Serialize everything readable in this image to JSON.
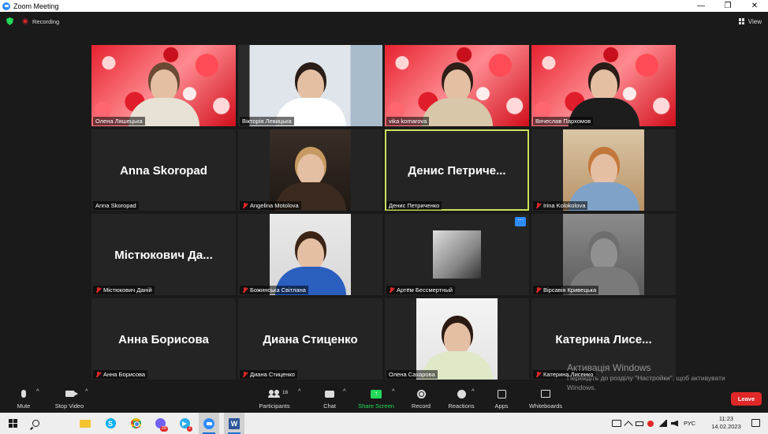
{
  "window": {
    "title": "Zoom Meeting",
    "minimize": "—",
    "restore": "❐",
    "close": "✕"
  },
  "status": {
    "recording_label": "Recording",
    "view_label": "View"
  },
  "tiles": [
    {
      "id": "olena-lyashchuk",
      "name": "Олена Ляшецька",
      "big": "",
      "muted": false,
      "video": "hearts"
    },
    {
      "id": "viktoriya",
      "name": "Вікторія Левицька",
      "big": "",
      "muted": false,
      "video": "room"
    },
    {
      "id": "vika",
      "name": "vika komarova",
      "big": "",
      "muted": false,
      "video": "hearts"
    },
    {
      "id": "vyacheslav",
      "name": "Вячеслав Пархомов",
      "big": "",
      "muted": false,
      "video": "hearts"
    },
    {
      "id": "anna-skoropad",
      "name": "Anna Skoropad",
      "big": "Anna Skoropad",
      "muted": false,
      "video": ""
    },
    {
      "id": "angelina",
      "name": "Angelina Motolova",
      "big": "",
      "muted": true,
      "video": "portrait"
    },
    {
      "id": "denys",
      "name": "Денис Петриченко",
      "big": "Денис  Петриче...",
      "muted": false,
      "video": "",
      "active": true
    },
    {
      "id": "irina",
      "name": "Irina Kolokolova",
      "big": "",
      "muted": true,
      "video": "chair"
    },
    {
      "id": "mistyukovych",
      "name": "Містюкович Даній",
      "big": "Містюкович  Да...",
      "muted": true,
      "video": ""
    },
    {
      "id": "bozhynska",
      "name": "Божинська Світлана",
      "big": "",
      "muted": true,
      "video": "blue"
    },
    {
      "id": "artem",
      "name": "Артём Бессмертный",
      "big": "",
      "muted": true,
      "video": "hand",
      "more": "···"
    },
    {
      "id": "virsaviya",
      "name": "Вірсавія Кривецька",
      "big": "",
      "muted": true,
      "video": "cat"
    },
    {
      "id": "anna-borysova",
      "name": "Анна Борисова",
      "big": "Анна Борисова",
      "muted": true,
      "video": ""
    },
    {
      "id": "diana",
      "name": "Диана Стиценко",
      "big": "Диана Стиценко",
      "muted": true,
      "video": ""
    },
    {
      "id": "olena-sakharova",
      "name": "Олена Сахарова",
      "big": "",
      "muted": false,
      "video": "woman"
    },
    {
      "id": "kateryna",
      "name": "Катерина Лисенко",
      "big": "Катерина  Лисе...",
      "muted": true,
      "video": ""
    }
  ],
  "toolbar": {
    "mute": "Mute",
    "stop_video": "Stop Video",
    "participants": "Participants",
    "participants_count": "16",
    "chat": "Chat",
    "share_screen": "Share Screen",
    "record": "Record",
    "reactions": "Reactions",
    "apps": "Apps",
    "whiteboards": "Whiteboards",
    "leave": "Leave"
  },
  "activation": {
    "title": "Активація Windows",
    "line1": "Перейдіть до розділу \"Настройки\", щоб активувати",
    "line2": "Windows."
  },
  "taskbar": {
    "viber_badge": "20",
    "telegram_badge": "2",
    "lang": "РУС",
    "time": "11:23",
    "date": "14.02.2023"
  },
  "colors": {
    "accent_blue": "#2d8cff",
    "share_green": "#23d959",
    "leave_red": "#e02828",
    "active_speaker": "#c9e25a"
  }
}
